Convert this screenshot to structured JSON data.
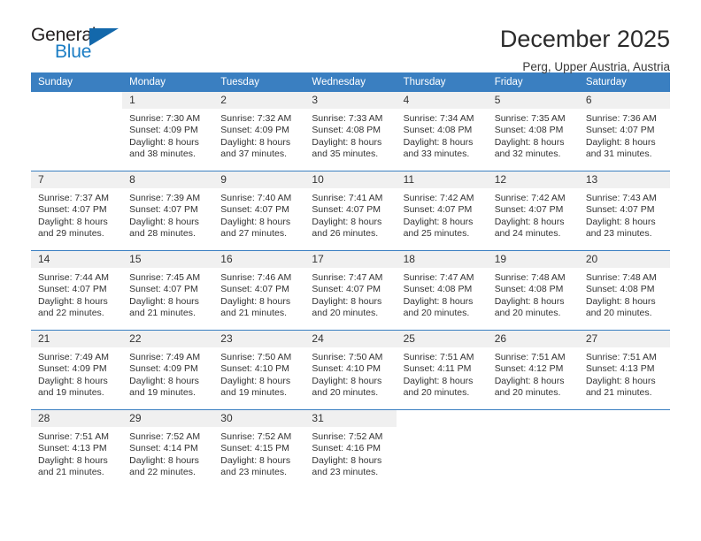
{
  "brand": {
    "name_top": "General",
    "name_bottom": "Blue",
    "triangle_icon": "triangle-icon",
    "color_dark": "#231f20",
    "color_blue": "#1b7dc4"
  },
  "header": {
    "month_title": "December 2025",
    "location": "Perg, Upper Austria, Austria",
    "accent_color": "#3a7fc1"
  },
  "calendar": {
    "weekday_headers": [
      "Sunday",
      "Monday",
      "Tuesday",
      "Wednesday",
      "Thursday",
      "Friday",
      "Saturday"
    ],
    "weeks": [
      [
        {
          "day": "",
          "lines": []
        },
        {
          "day": "1",
          "lines": [
            "Sunrise: 7:30 AM",
            "Sunset: 4:09 PM",
            "Daylight: 8 hours",
            "and 38 minutes."
          ]
        },
        {
          "day": "2",
          "lines": [
            "Sunrise: 7:32 AM",
            "Sunset: 4:09 PM",
            "Daylight: 8 hours",
            "and 37 minutes."
          ]
        },
        {
          "day": "3",
          "lines": [
            "Sunrise: 7:33 AM",
            "Sunset: 4:08 PM",
            "Daylight: 8 hours",
            "and 35 minutes."
          ]
        },
        {
          "day": "4",
          "lines": [
            "Sunrise: 7:34 AM",
            "Sunset: 4:08 PM",
            "Daylight: 8 hours",
            "and 33 minutes."
          ]
        },
        {
          "day": "5",
          "lines": [
            "Sunrise: 7:35 AM",
            "Sunset: 4:08 PM",
            "Daylight: 8 hours",
            "and 32 minutes."
          ]
        },
        {
          "day": "6",
          "lines": [
            "Sunrise: 7:36 AM",
            "Sunset: 4:07 PM",
            "Daylight: 8 hours",
            "and 31 minutes."
          ]
        }
      ],
      [
        {
          "day": "7",
          "lines": [
            "Sunrise: 7:37 AM",
            "Sunset: 4:07 PM",
            "Daylight: 8 hours",
            "and 29 minutes."
          ]
        },
        {
          "day": "8",
          "lines": [
            "Sunrise: 7:39 AM",
            "Sunset: 4:07 PM",
            "Daylight: 8 hours",
            "and 28 minutes."
          ]
        },
        {
          "day": "9",
          "lines": [
            "Sunrise: 7:40 AM",
            "Sunset: 4:07 PM",
            "Daylight: 8 hours",
            "and 27 minutes."
          ]
        },
        {
          "day": "10",
          "lines": [
            "Sunrise: 7:41 AM",
            "Sunset: 4:07 PM",
            "Daylight: 8 hours",
            "and 26 minutes."
          ]
        },
        {
          "day": "11",
          "lines": [
            "Sunrise: 7:42 AM",
            "Sunset: 4:07 PM",
            "Daylight: 8 hours",
            "and 25 minutes."
          ]
        },
        {
          "day": "12",
          "lines": [
            "Sunrise: 7:42 AM",
            "Sunset: 4:07 PM",
            "Daylight: 8 hours",
            "and 24 minutes."
          ]
        },
        {
          "day": "13",
          "lines": [
            "Sunrise: 7:43 AM",
            "Sunset: 4:07 PM",
            "Daylight: 8 hours",
            "and 23 minutes."
          ]
        }
      ],
      [
        {
          "day": "14",
          "lines": [
            "Sunrise: 7:44 AM",
            "Sunset: 4:07 PM",
            "Daylight: 8 hours",
            "and 22 minutes."
          ]
        },
        {
          "day": "15",
          "lines": [
            "Sunrise: 7:45 AM",
            "Sunset: 4:07 PM",
            "Daylight: 8 hours",
            "and 21 minutes."
          ]
        },
        {
          "day": "16",
          "lines": [
            "Sunrise: 7:46 AM",
            "Sunset: 4:07 PM",
            "Daylight: 8 hours",
            "and 21 minutes."
          ]
        },
        {
          "day": "17",
          "lines": [
            "Sunrise: 7:47 AM",
            "Sunset: 4:07 PM",
            "Daylight: 8 hours",
            "and 20 minutes."
          ]
        },
        {
          "day": "18",
          "lines": [
            "Sunrise: 7:47 AM",
            "Sunset: 4:08 PM",
            "Daylight: 8 hours",
            "and 20 minutes."
          ]
        },
        {
          "day": "19",
          "lines": [
            "Sunrise: 7:48 AM",
            "Sunset: 4:08 PM",
            "Daylight: 8 hours",
            "and 20 minutes."
          ]
        },
        {
          "day": "20",
          "lines": [
            "Sunrise: 7:48 AM",
            "Sunset: 4:08 PM",
            "Daylight: 8 hours",
            "and 20 minutes."
          ]
        }
      ],
      [
        {
          "day": "21",
          "lines": [
            "Sunrise: 7:49 AM",
            "Sunset: 4:09 PM",
            "Daylight: 8 hours",
            "and 19 minutes."
          ]
        },
        {
          "day": "22",
          "lines": [
            "Sunrise: 7:49 AM",
            "Sunset: 4:09 PM",
            "Daylight: 8 hours",
            "and 19 minutes."
          ]
        },
        {
          "day": "23",
          "lines": [
            "Sunrise: 7:50 AM",
            "Sunset: 4:10 PM",
            "Daylight: 8 hours",
            "and 19 minutes."
          ]
        },
        {
          "day": "24",
          "lines": [
            "Sunrise: 7:50 AM",
            "Sunset: 4:10 PM",
            "Daylight: 8 hours",
            "and 20 minutes."
          ]
        },
        {
          "day": "25",
          "lines": [
            "Sunrise: 7:51 AM",
            "Sunset: 4:11 PM",
            "Daylight: 8 hours",
            "and 20 minutes."
          ]
        },
        {
          "day": "26",
          "lines": [
            "Sunrise: 7:51 AM",
            "Sunset: 4:12 PM",
            "Daylight: 8 hours",
            "and 20 minutes."
          ]
        },
        {
          "day": "27",
          "lines": [
            "Sunrise: 7:51 AM",
            "Sunset: 4:13 PM",
            "Daylight: 8 hours",
            "and 21 minutes."
          ]
        }
      ],
      [
        {
          "day": "28",
          "lines": [
            "Sunrise: 7:51 AM",
            "Sunset: 4:13 PM",
            "Daylight: 8 hours",
            "and 21 minutes."
          ]
        },
        {
          "day": "29",
          "lines": [
            "Sunrise: 7:52 AM",
            "Sunset: 4:14 PM",
            "Daylight: 8 hours",
            "and 22 minutes."
          ]
        },
        {
          "day": "30",
          "lines": [
            "Sunrise: 7:52 AM",
            "Sunset: 4:15 PM",
            "Daylight: 8 hours",
            "and 23 minutes."
          ]
        },
        {
          "day": "31",
          "lines": [
            "Sunrise: 7:52 AM",
            "Sunset: 4:16 PM",
            "Daylight: 8 hours",
            "and 23 minutes."
          ]
        },
        {
          "day": "",
          "lines": []
        },
        {
          "day": "",
          "lines": []
        },
        {
          "day": "",
          "lines": []
        }
      ]
    ]
  }
}
